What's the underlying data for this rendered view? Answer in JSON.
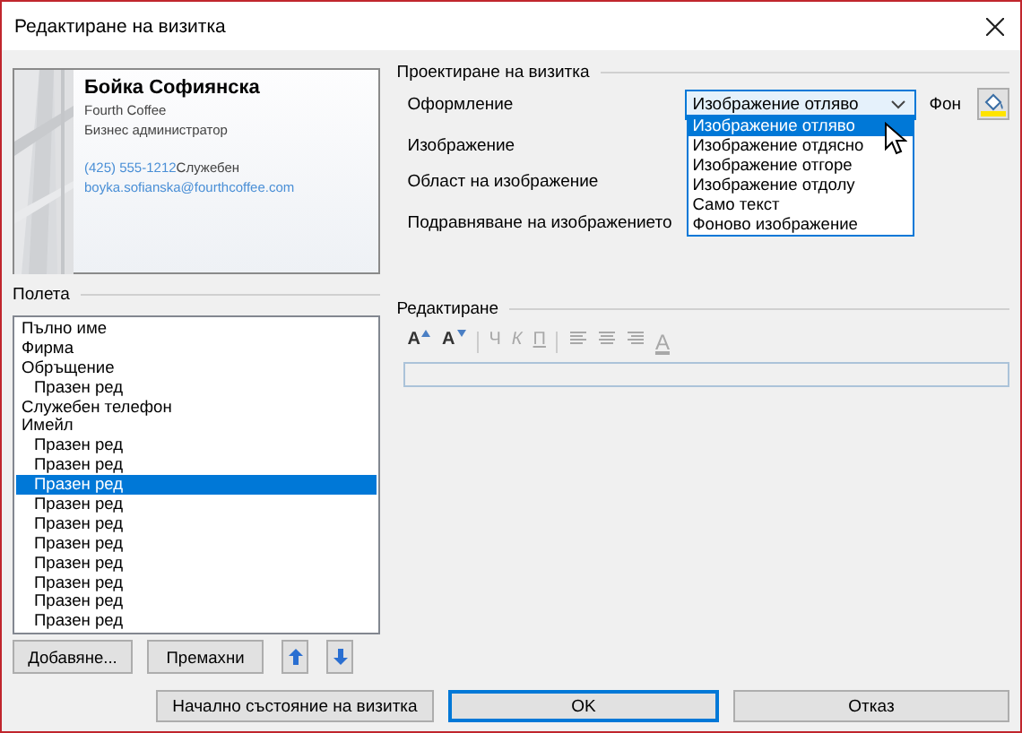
{
  "window": {
    "title": "Редактиране на визитка"
  },
  "card": {
    "name": "Бойка Софиянска",
    "company": "Fourth Coffee",
    "job_title": "Бизнес администратор",
    "phone": "(425) 555-1212",
    "phone_label": "Служебен",
    "email": "boyka.sofianska@fourthcoffee.com"
  },
  "design": {
    "heading": "Проектиране на визитка",
    "layout_label": "Оформление",
    "layout_value": "Изображение отляво",
    "expanded": true,
    "layout_options": [
      {
        "label": "Изображение отляво",
        "selected": true
      },
      {
        "label": "Изображение отдясно",
        "selected": false
      },
      {
        "label": "Изображение отгоре",
        "selected": false
      },
      {
        "label": "Изображение отдолу",
        "selected": false
      },
      {
        "label": "Само текст",
        "selected": false
      },
      {
        "label": "Фоново изображение",
        "selected": false
      }
    ],
    "background_label": "Фон",
    "image_label": "Изображение",
    "image_area_label": "Област на изображение",
    "image_align_label": "Подравняване на изображението"
  },
  "fields": {
    "heading": "Полета",
    "items": [
      {
        "label": "Пълно име",
        "selected": false
      },
      {
        "label": "Фирма",
        "selected": false
      },
      {
        "label": "Обръщение",
        "selected": false,
        "children": [
          {
            "label": "Празен ред",
            "selected": false
          }
        ]
      },
      {
        "label": "Служебен телефон",
        "selected": false
      },
      {
        "label": "Имейл",
        "selected": false,
        "children": [
          {
            "label": "Празен ред",
            "selected": false
          },
          {
            "label": "Празен ред",
            "selected": false
          },
          {
            "label": "Празен ред",
            "selected": true
          },
          {
            "label": "Празен ред",
            "selected": false
          },
          {
            "label": "Празен ред",
            "selected": false
          },
          {
            "label": "Празен ред",
            "selected": false
          },
          {
            "label": "Празен ред",
            "selected": false
          },
          {
            "label": "Празен ред",
            "selected": false
          },
          {
            "label": "Празен ред",
            "selected": false
          },
          {
            "label": "Празен ред",
            "selected": false
          }
        ]
      }
    ],
    "add_button": "Добавяне...",
    "remove_button": "Премахни"
  },
  "editing": {
    "heading": "Редактиране",
    "tools": [
      {
        "kind": "grow",
        "label": "A",
        "disabled": false
      },
      {
        "kind": "shrink",
        "label": "A",
        "disabled": false
      },
      {
        "kind": "separator"
      },
      {
        "kind": "bold",
        "label": "Ч",
        "disabled": true
      },
      {
        "kind": "italic",
        "label": "К",
        "disabled": true
      },
      {
        "kind": "underline",
        "label": "П",
        "disabled": true
      },
      {
        "kind": "separator"
      },
      {
        "kind": "align-left",
        "disabled": true
      },
      {
        "kind": "align-center",
        "disabled": true
      },
      {
        "kind": "align-right",
        "disabled": true
      },
      {
        "kind": "font-color",
        "label": "A",
        "disabled": true
      }
    ]
  },
  "buttons": [
    {
      "label": "Начално състояние на визитка",
      "default": false
    },
    {
      "label": "OK",
      "default": true
    },
    {
      "label": "Отказ",
      "default": false
    }
  ]
}
